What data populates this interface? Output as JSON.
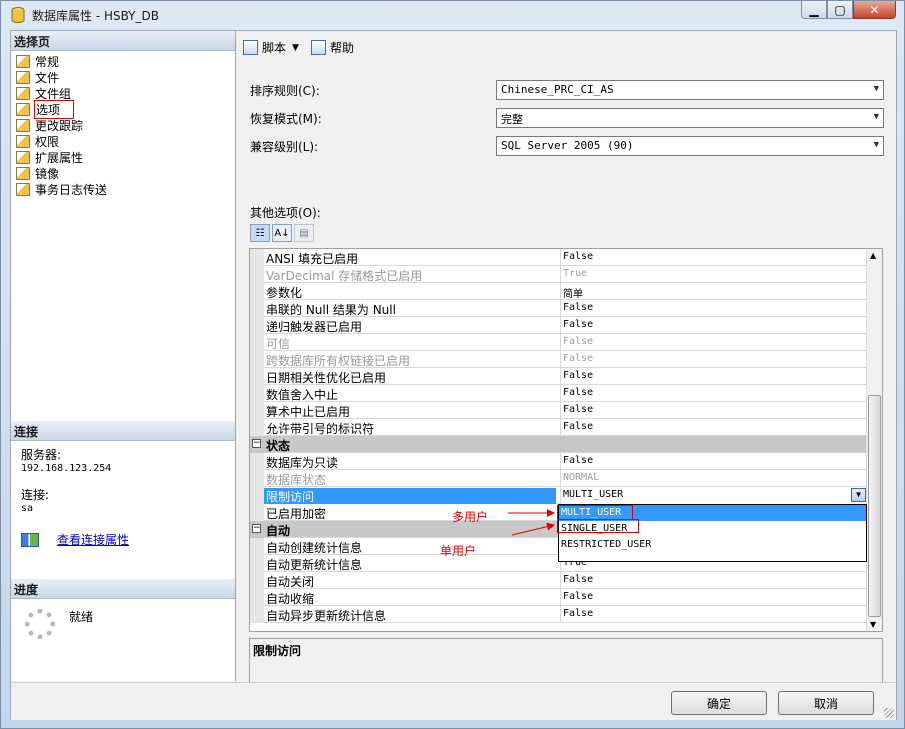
{
  "window": {
    "title": "数据库属性 - HSBY_DB",
    "minimize_glyph": "▁",
    "maximize_glyph": "▢",
    "close_glyph": "✕"
  },
  "left": {
    "pages_header": "选择页",
    "pages": [
      {
        "label": "常规"
      },
      {
        "label": "文件"
      },
      {
        "label": "文件组"
      },
      {
        "label": "选项"
      },
      {
        "label": "更改跟踪"
      },
      {
        "label": "权限"
      },
      {
        "label": "扩展属性"
      },
      {
        "label": "镜像"
      },
      {
        "label": "事务日志传送"
      }
    ],
    "connection_header": "连接",
    "server_label": "服务器:",
    "server_value": "192.168.123.254",
    "conn_label": "连接:",
    "conn_value": "sa",
    "view_link": "查看连接属性",
    "progress_header": "进度",
    "progress_status": "就绪"
  },
  "toolbar": {
    "script_label": "脚本",
    "help_label": "帮助",
    "dropdown_glyph": "▼"
  },
  "fields": {
    "collation_label": "排序规则(C):",
    "collation_value": "Chinese_PRC_CI_AS",
    "recovery_label": "恢复模式(M):",
    "recovery_value": "完整",
    "compat_label": "兼容级别(L):",
    "compat_value": "SQL Server 2005 (90)",
    "other_label": "其他选项(O):",
    "combo_arrow": "▼"
  },
  "grid": {
    "rows1": [
      {
        "name": "ANSI 填充已启用",
        "value": "False",
        "disabled": false
      },
      {
        "name": "VarDecimal 存储格式已启用",
        "value": "True",
        "disabled": true
      },
      {
        "name": "参数化",
        "value": "简单",
        "disabled": false
      },
      {
        "name": "串联的 Null 结果为 Null",
        "value": "False",
        "disabled": false
      },
      {
        "name": "递归触发器已启用",
        "value": "False",
        "disabled": false
      },
      {
        "name": "可信",
        "value": "False",
        "disabled": true
      },
      {
        "name": "跨数据库所有权链接已启用",
        "value": "False",
        "disabled": true
      },
      {
        "name": "日期相关性优化已启用",
        "value": "False",
        "disabled": false
      },
      {
        "name": "数值舍入中止",
        "value": "False",
        "disabled": false
      },
      {
        "name": "算术中止已启用",
        "value": "False",
        "disabled": false
      },
      {
        "name": "允许带引号的标识符",
        "value": "False",
        "disabled": false
      }
    ],
    "cat_state": "状态",
    "cat_toggle": "−",
    "rows2": [
      {
        "name": "数据库为只读",
        "value": "False",
        "disabled": false
      },
      {
        "name": "数据库状态",
        "value": "NORMAL",
        "disabled": true
      }
    ],
    "selected_row": {
      "name": "限制访问",
      "value": "MULTI_USER"
    },
    "row_encrypt": {
      "name": "已启用加密",
      "value": ""
    },
    "cat_auto": "自动",
    "rows3": [
      {
        "name": "自动创建统计信息",
        "value": ""
      },
      {
        "name": "自动更新统计信息",
        "value": "True"
      },
      {
        "name": "自动关闭",
        "value": "False"
      },
      {
        "name": "自动收缩",
        "value": "False"
      },
      {
        "name": "自动异步更新统计信息",
        "value": "False"
      }
    ],
    "dropdown_options": [
      "MULTI_USER",
      "SINGLE_USER",
      "RESTRICTED_USER"
    ],
    "scroll_up": "▲",
    "scroll_down": "▼",
    "grip": "≡"
  },
  "annotations": {
    "multi": "多用户",
    "single": "单用户"
  },
  "description": {
    "title": "限制访问"
  },
  "buttons": {
    "ok": "确定",
    "cancel": "取消"
  },
  "pg_toolbar": {
    "categorized_glyph": "☷",
    "alpha_glyph": "A↓",
    "pages_glyph": "▤"
  }
}
